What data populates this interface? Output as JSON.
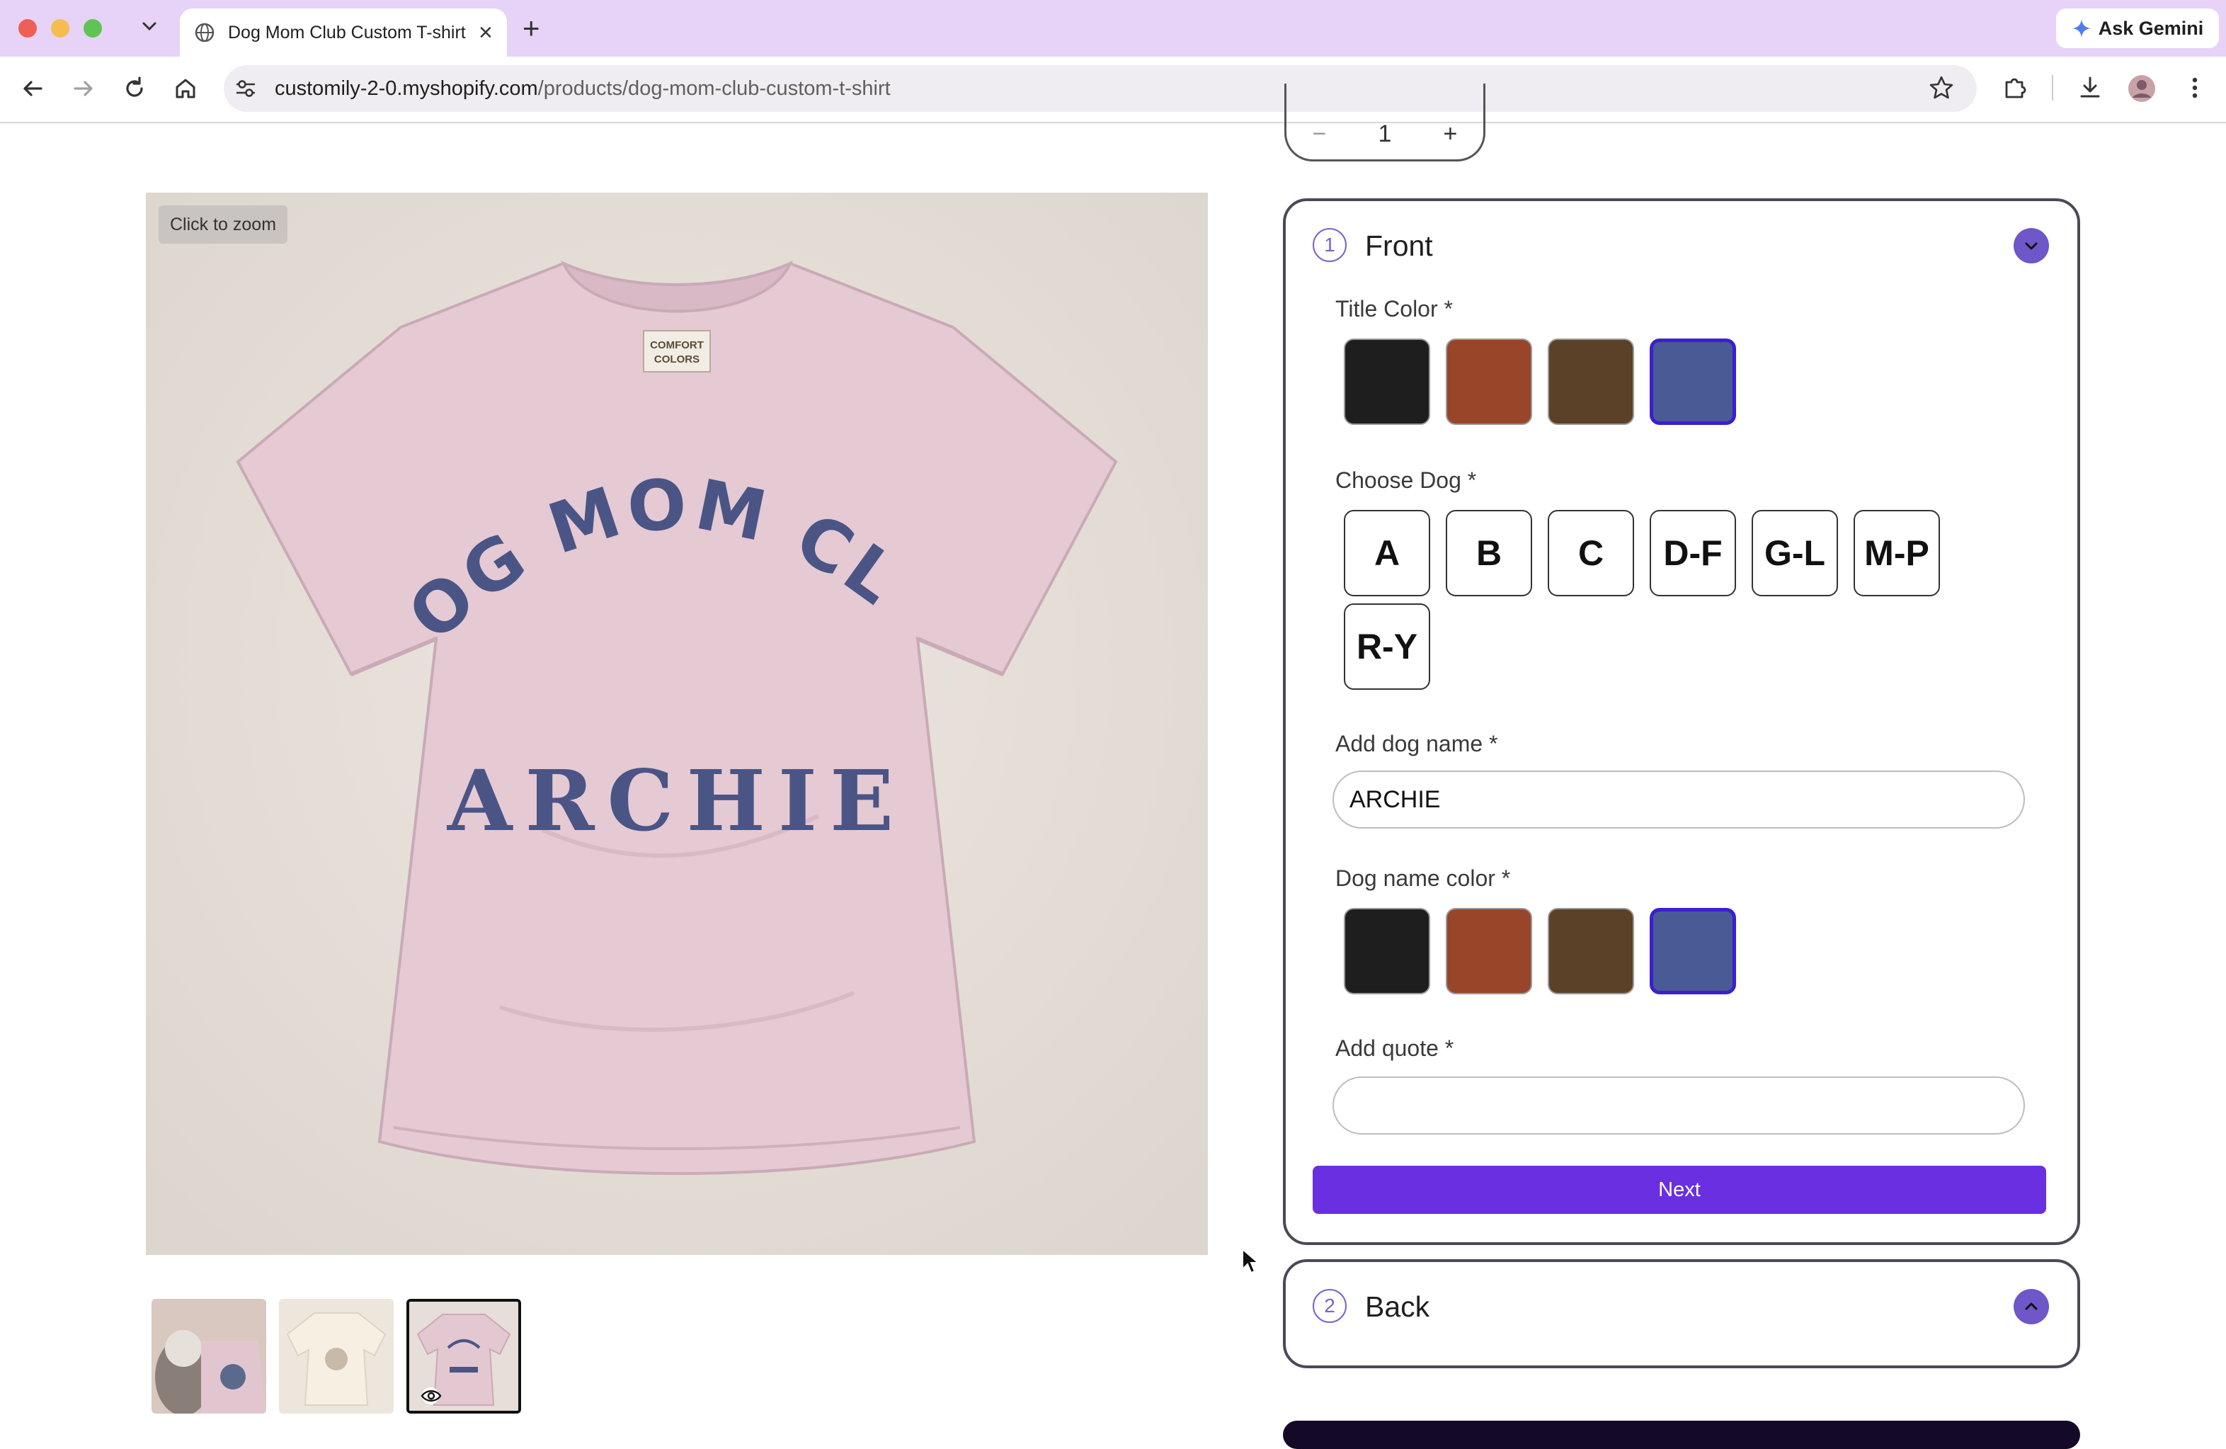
{
  "browser": {
    "tab_title": "Dog Mom Club Custom T-shirt",
    "gemini_label": "Ask Gemini",
    "url_host": "customily-2-0.myshopify.com",
    "url_path": "/products/dog-mom-club-custom-t-shirt"
  },
  "quantity": {
    "minus": "−",
    "value": "1",
    "plus": "+"
  },
  "gallery": {
    "zoom_label": "Click to zoom",
    "shirt_color": "#e5c9d3",
    "print_color": "#4a5586",
    "arc_text": "DOG MOM CLUB",
    "name_text": "ARCHIE",
    "tag_line1": "COMFORT",
    "tag_line2": "COLORS",
    "thumbnails": [
      "thumbnail-1",
      "thumbnail-2",
      "thumbnail-3"
    ],
    "active_thumbnail_index": 2
  },
  "front_step": {
    "number": "1",
    "title": "Front",
    "title_color": {
      "label": "Title Color *",
      "swatches": [
        "#1e1e1e",
        "#98452a",
        "#5b4128",
        "#4a5a94"
      ],
      "selected_index": 3
    },
    "choose_dog": {
      "label": "Choose Dog *",
      "options": [
        "A",
        "B",
        "C",
        "D-F",
        "G-L",
        "M-P",
        "R-Y"
      ]
    },
    "dog_name": {
      "label": "Add dog name *",
      "value": "ARCHIE"
    },
    "dog_name_color": {
      "label": "Dog name color *",
      "swatches": [
        "#1e1e1e",
        "#98452a",
        "#5b4128",
        "#4a5a94"
      ],
      "selected_index": 3
    },
    "quote": {
      "label": "Add quote *",
      "value": ""
    },
    "next_label": "Next"
  },
  "back_step": {
    "number": "2",
    "title": "Back"
  }
}
